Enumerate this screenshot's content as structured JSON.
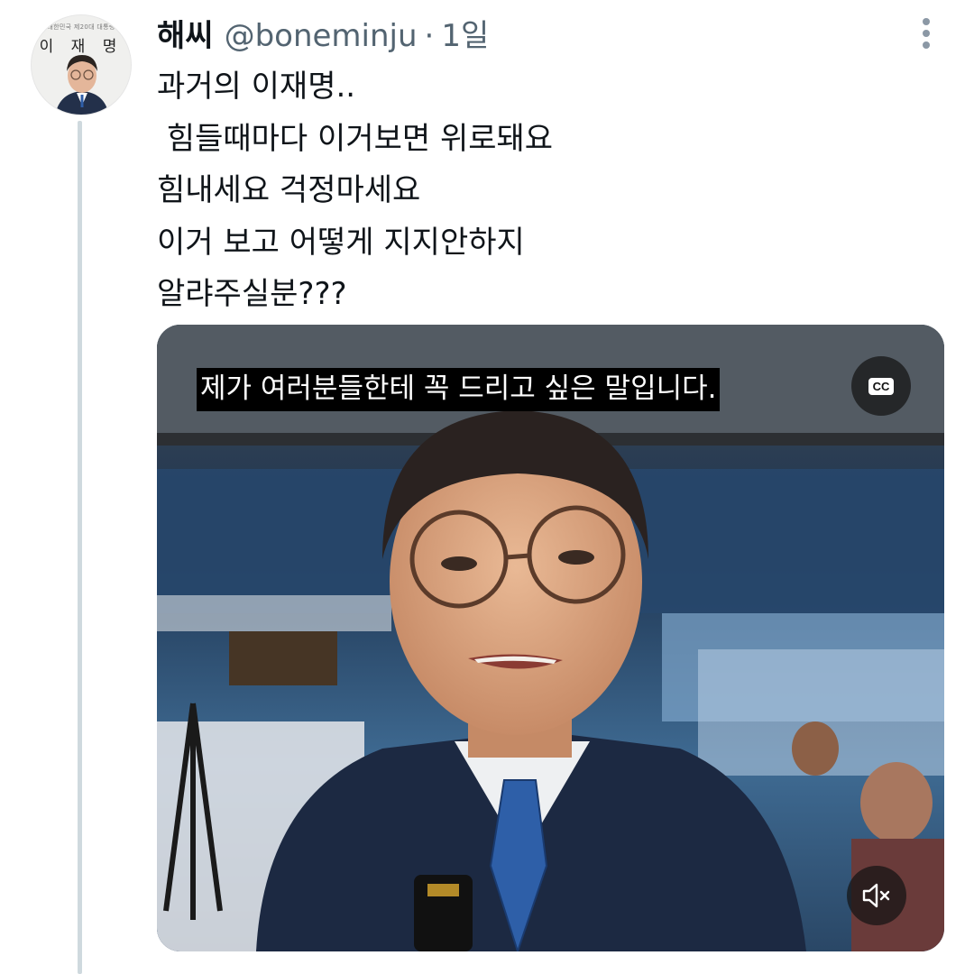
{
  "profile": {
    "avatar_label": "이 재 명",
    "avatar_sublabel": "대한민국 제20대 대통령"
  },
  "tweet": {
    "display_name": "해씨",
    "handle": "@boneminju",
    "separator": "·",
    "time": "1일",
    "lines": [
      "과거의 이재명..",
      " 힘들때마다 이거보면 위로돼요",
      "힘내세요 걱정마세요",
      "이거 보고 어떻게 지지안하지",
      "알랴주실분???"
    ]
  },
  "video": {
    "subtitle": "제가 여러분들한테 꼭 드리고 싶은 말입니다.",
    "cc_label": "CC"
  },
  "icons": {
    "more": "more-vertical-icon",
    "cc": "closed-captions-icon",
    "mute": "muted-speaker-icon"
  },
  "colors": {
    "text_primary": "#0f1419",
    "text_secondary": "#536471",
    "thread_line": "#cfd9de"
  }
}
